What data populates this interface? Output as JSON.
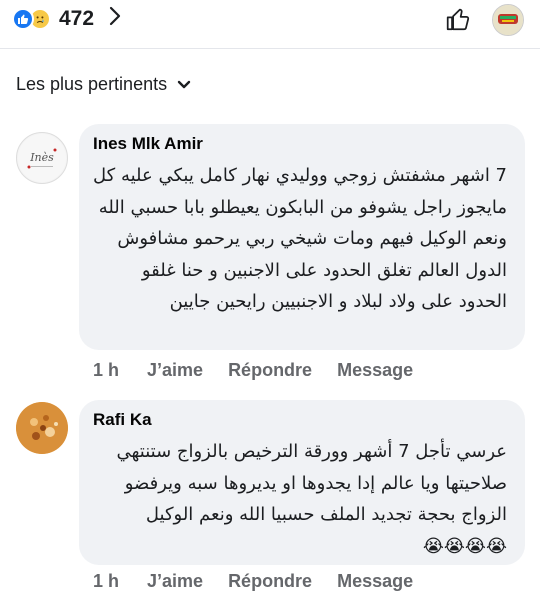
{
  "reactions": {
    "count": "472",
    "like_icon": "thumbs-up-icon",
    "sad_icon": "sad-face-icon",
    "like_color": "#1877f2",
    "sad_color": "#f7c948"
  },
  "sort": {
    "label": "Les plus pertinents"
  },
  "comments": [
    {
      "author": "Ines Mlk Amir",
      "avatar_text": "Inès",
      "text": "7 اشهر مشفتش زوجي ووليدي نهار كامل يبكي عليه كل مايجوز راجل يشوفو من البابكون يعيطلو بابا حسبي الله ونعم الوكيل فيهم ومات شيخي ربي يرحمو مشافوش الدول العالم تغلق الحدود على الاجنبين و حنا غلقو الحدود على ولاد لبلاد و الاجنبيين رايحين جايين",
      "time": "1 h",
      "like_label": "J’aime",
      "reply_label": "Répondre",
      "message_label": "Message"
    },
    {
      "author": "Rafi Ka",
      "text": "عرسي تأجل 7 أشهر وورقة الترخيص بالزواج ستنتهي صلاحيتها ويا عالم إدا يجدوها او يديروها سبه ويرفضو الزواج بحجة تجديد الملف حسبيا الله ونعم الوكيل",
      "emoji": "😭😭😭😭",
      "time": "1 h",
      "like_label": "J’aime",
      "reply_label": "Répondre",
      "message_label": "Message"
    }
  ]
}
